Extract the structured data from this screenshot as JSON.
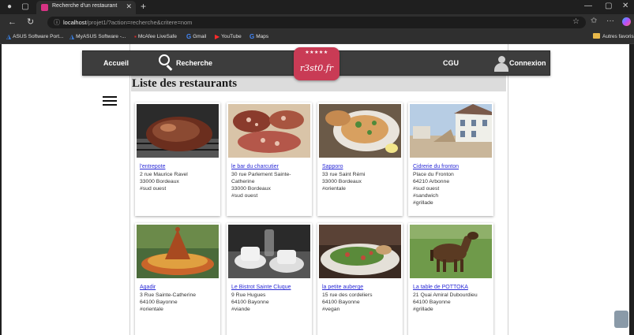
{
  "browser": {
    "tab_title": "Recherche d'un restaurant",
    "url_host": "localhost",
    "url_path": "/projet1/?action=recherche&critere=nom",
    "favorites": [
      "ASUS Software Port...",
      "MyASUS Software -...",
      "McAfee LiveSafe",
      "Gmail",
      "YouTube",
      "Maps"
    ],
    "favorites_folder": "Autres favoris"
  },
  "site": {
    "nav": {
      "home": "Accueil",
      "search": "Recherche",
      "cgu": "CGU",
      "login": "Connexion"
    },
    "logo": {
      "stars": "★★★★★",
      "text": "r3st0.fr"
    },
    "page_title": "Liste des restaurants"
  },
  "restaurants": [
    {
      "name": "l'entrepote",
      "lines": [
        "2 rue Maurice Ravel",
        "33000 Bordeaux",
        "#sud ouest"
      ]
    },
    {
      "name": "le bar du charcutier",
      "lines": [
        "30 rue Parlement Sainte-",
        "Catherine",
        "33000 Bordeaux",
        "#sud ouest"
      ]
    },
    {
      "name": "Sapporo",
      "lines": [
        "33 rue Saint Rémi",
        "33000 Bordeaux",
        "#orientale"
      ]
    },
    {
      "name": "Cidrerie du fronton",
      "lines": [
        "Place du Fronton",
        "64210 Arbonne",
        "#sud ouest",
        "#sandwich",
        "#grillade"
      ]
    },
    {
      "name": "Agadir",
      "lines": [
        "3 Rue Sainte-Catherine",
        "64100 Bayonne",
        "#orientale"
      ]
    },
    {
      "name": "Le Bistrot Sainte Cluque",
      "lines": [
        "9 Rue Hugues",
        "64100 Bayonne",
        "#viande"
      ]
    },
    {
      "name": "la petite auberge",
      "lines": [
        "15 rue des cordeliers",
        "64100 Bayonne",
        "#vegan"
      ]
    },
    {
      "name": "La table de POTTOKA",
      "lines": [
        "21 Quai Amiral Dubourdieu",
        "64100 Bayonne",
        "#grillade"
      ]
    }
  ]
}
